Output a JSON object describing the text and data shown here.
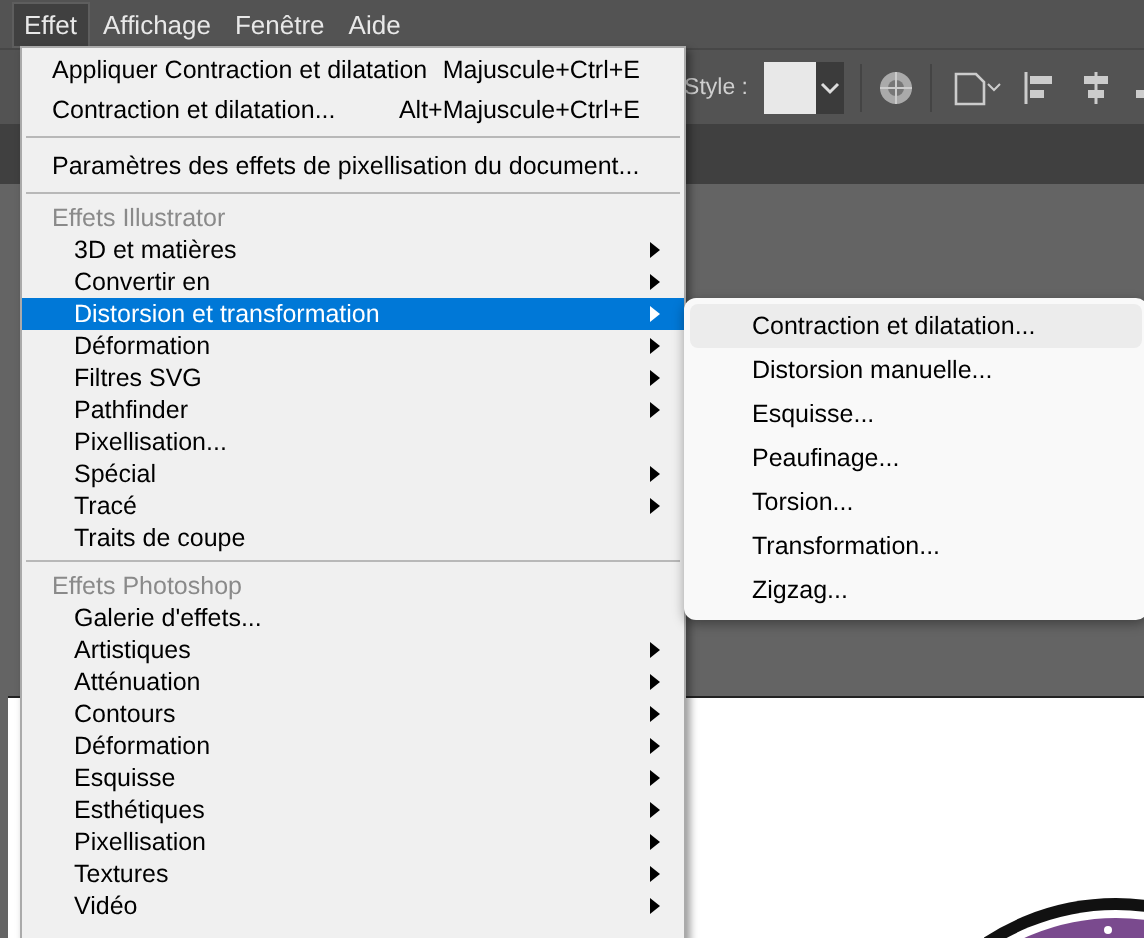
{
  "menubar": [
    {
      "label": "Effet",
      "selected": true
    },
    {
      "label": "Affichage",
      "selected": false
    },
    {
      "label": "Fenêtre",
      "selected": false
    },
    {
      "label": "Aide",
      "selected": false
    }
  ],
  "toolbar": {
    "style_label": "Style :"
  },
  "menu": [
    {
      "kind": "command",
      "label": "Appliquer Contraction et dilatation",
      "shortcut": "Majuscule+Ctrl+E"
    },
    {
      "kind": "command",
      "label": "Contraction et dilatation...",
      "shortcut": "Alt+Majuscule+Ctrl+E"
    },
    {
      "kind": "separator"
    },
    {
      "kind": "command",
      "label": "Paramètres des effets de pixellisation du document..."
    },
    {
      "kind": "separator"
    },
    {
      "kind": "header",
      "label": "Effets Illustrator"
    },
    {
      "kind": "submenu",
      "label": "3D et matières",
      "selected": false
    },
    {
      "kind": "submenu",
      "label": "Convertir en",
      "selected": false
    },
    {
      "kind": "submenu",
      "label": "Distorsion et transformation",
      "selected": true
    },
    {
      "kind": "submenu",
      "label": "Déformation",
      "selected": false
    },
    {
      "kind": "submenu",
      "label": "Filtres SVG",
      "selected": false
    },
    {
      "kind": "submenu",
      "label": "Pathfinder",
      "selected": false
    },
    {
      "kind": "item",
      "label": "Pixellisation...",
      "selected": false
    },
    {
      "kind": "submenu",
      "label": "Spécial",
      "selected": false
    },
    {
      "kind": "submenu",
      "label": "Tracé",
      "selected": false
    },
    {
      "kind": "item",
      "label": "Traits de coupe",
      "selected": false
    },
    {
      "kind": "separator"
    },
    {
      "kind": "header",
      "label": "Effets Photoshop"
    },
    {
      "kind": "item",
      "label": "Galerie d'effets...",
      "selected": false
    },
    {
      "kind": "submenu",
      "label": "Artistiques",
      "selected": false
    },
    {
      "kind": "submenu",
      "label": "Atténuation",
      "selected": false
    },
    {
      "kind": "submenu",
      "label": "Contours",
      "selected": false
    },
    {
      "kind": "submenu",
      "label": "Déformation",
      "selected": false
    },
    {
      "kind": "submenu",
      "label": "Esquisse",
      "selected": false
    },
    {
      "kind": "submenu",
      "label": "Esthétiques",
      "selected": false
    },
    {
      "kind": "submenu",
      "label": "Pixellisation",
      "selected": false
    },
    {
      "kind": "submenu",
      "label": "Textures",
      "selected": false
    },
    {
      "kind": "submenu",
      "label": "Vidéo",
      "selected": false
    }
  ],
  "submenu": [
    {
      "label": "Contraction et dilatation...",
      "selected": true
    },
    {
      "label": "Distorsion manuelle...",
      "selected": false
    },
    {
      "label": "Esquisse...",
      "selected": false
    },
    {
      "label": "Peaufinage...",
      "selected": false
    },
    {
      "label": "Torsion...",
      "selected": false
    },
    {
      "label": "Transformation...",
      "selected": false
    },
    {
      "label": "Zigzag...",
      "selected": false
    }
  ]
}
